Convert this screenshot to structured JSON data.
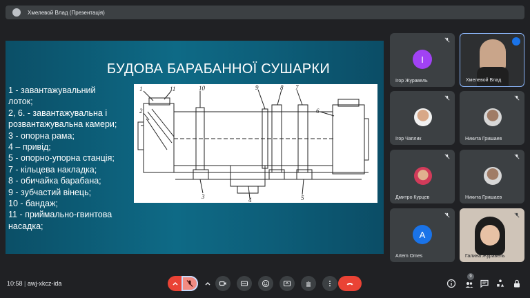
{
  "top_bar": {
    "presenter_title": "Хмелевой Влад (Презентація)"
  },
  "slide": {
    "title": "БУДОВА БАРАБАННОЇ СУШАРКИ",
    "legend_lines": [
      "1 - завантажувальний",
      "лоток;",
      "2, 6. - завантажувальна і",
      "розвантажувальна камери;",
      "3 - опорна рама;",
      "4 – привід;",
      "5 - опорно-упорна станція;",
      "7 - кільцева накладка;",
      "8 - обичайка барабана;",
      "9 - зубчастий вінець;",
      "10 - бандаж;",
      "11 - приймально-гвинтова",
      "насадка;"
    ],
    "drawing_labels": [
      "1",
      "11",
      "10",
      "2",
      "9",
      "8",
      "7",
      "6",
      "3",
      "4",
      "5"
    ]
  },
  "participants": [
    {
      "name": "Ігор Журавель",
      "avatar": "I",
      "avatar_color": "#a142f4",
      "mic": "muted"
    },
    {
      "name": "Хмелевой Влад",
      "avatar": "video",
      "mic": "speaking"
    },
    {
      "name": "Ігор Чаплик",
      "avatar": "photo",
      "mic": "muted"
    },
    {
      "name": "Никита Гришаев",
      "avatar": "photo",
      "mic": "muted"
    },
    {
      "name": "Дмитро Курцев",
      "avatar": "photo",
      "mic": "muted"
    },
    {
      "name": "Никита Гришаев",
      "avatar": "photo",
      "mic": "muted"
    },
    {
      "name": "Artem Omes",
      "avatar": "A",
      "avatar_color": "#1a73e8",
      "mic": "muted"
    },
    {
      "name": "Галина Журавель",
      "avatar": "video",
      "mic": "muted"
    }
  ],
  "bottom_bar": {
    "time": "10:58",
    "meeting_code": "awj-xkcz-ida",
    "participant_count": "9",
    "colors": {
      "mic_muted": "#ea4335",
      "end_call": "#ea4335",
      "control_bg": "#3c4043",
      "accent": "#8ab4f8"
    },
    "icons": [
      "chevron-up-icon",
      "mic-off-icon",
      "chevron-up-icon",
      "camera-icon",
      "captions-icon",
      "emoji-icon",
      "present-icon",
      "raise-hand-icon",
      "more-icon",
      "end-call-icon",
      "info-icon",
      "people-icon",
      "chat-icon",
      "activities-icon",
      "lock-icon"
    ]
  }
}
